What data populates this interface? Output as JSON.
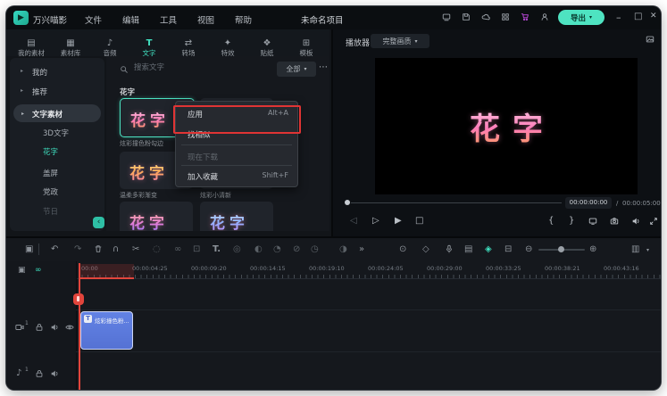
{
  "titlebar": {
    "app_name": "万兴喵影",
    "menus": [
      "文件",
      "编辑",
      "工具",
      "视图",
      "帮助"
    ],
    "project_title": "未命名项目",
    "export_label": "导出"
  },
  "tabs": [
    {
      "label": "我的素材",
      "glyph": "▤"
    },
    {
      "label": "素材库",
      "glyph": "▦"
    },
    {
      "label": "音频",
      "glyph": "♪"
    },
    {
      "label": "文字",
      "glyph": "T"
    },
    {
      "label": "转场",
      "glyph": "⇄"
    },
    {
      "label": "特效",
      "glyph": "✦"
    },
    {
      "label": "贴纸",
      "glyph": "❖"
    },
    {
      "label": "模板",
      "glyph": "⊞"
    }
  ],
  "sidebar": {
    "groups": [
      {
        "label": "我的"
      },
      {
        "label": "推荐"
      },
      {
        "label": "文字素材"
      }
    ],
    "subitems": [
      {
        "label": "3D文字"
      },
      {
        "label": "花字"
      },
      {
        "label": "盖屏"
      },
      {
        "label": "党政"
      },
      {
        "label": "节日"
      }
    ]
  },
  "media_panel": {
    "search_placeholder": "搜索文字",
    "filter_label": "全部",
    "section_title": "花字",
    "cards": [
      {
        "text": "花字",
        "caption": "炫彩撞色粉勾边"
      },
      {
        "text": "花字",
        "caption": "温柔多彩渐变"
      },
      {
        "caption": "炫彩小清新"
      },
      {
        "text": "花字"
      },
      {
        "text": "花字"
      }
    ]
  },
  "context_menu": {
    "items": [
      {
        "label": "应用",
        "shortcut": "Alt+A"
      },
      {
        "label": "找相似",
        "shortcut": ""
      },
      {
        "label": "现在下载",
        "shortcut": ""
      },
      {
        "label": "加入收藏",
        "shortcut": "Shift+F"
      }
    ]
  },
  "preview": {
    "panel_title": "播放器",
    "quality_label": "完整画质",
    "overlay_text": "花字",
    "current_time": "00:00:00:00",
    "separator": "/",
    "total_time": "00:00:05:00"
  },
  "timeline": {
    "ruler_labels": [
      "00:00",
      "00:00:04:25",
      "00:00:09:20",
      "00:00:14:15",
      "00:00:19:10",
      "00:00:24:05",
      "00:00:29:00",
      "00:00:33:25",
      "00:00:38:21",
      "00:00:43:16"
    ],
    "clip": {
      "badge": "T",
      "label": "炫彩撞色粉..."
    },
    "video_track_number": "1",
    "audio_track_number": "1"
  },
  "colors": {
    "accent": "#41e0c0",
    "red": "#e2453c",
    "clip_blue": "#5b7ade",
    "cart_purple": "#c04ae0"
  },
  "glyphs": {
    "logo": "▶",
    "minimize": "–",
    "maximize": "□",
    "close": "✕",
    "chevron_down": "▾",
    "caret_right": "▸",
    "more": "⋯",
    "collapse": "‹",
    "manage": "▣",
    "undo": "↶",
    "redo": "↷",
    "magnet": "∩",
    "split": "✂",
    "ripple": "◌",
    "link": "∞",
    "crop": "⊡",
    "text_tool": "T.",
    "motion": "◎",
    "chroma": "◐",
    "speed": "◔",
    "render": "⊘",
    "clock": "◷",
    "mask": "◑",
    "more_tools": "»",
    "record": "⊙",
    "shield": "◇",
    "preview_render": "▤",
    "keyframe": "◈",
    "marker": "⊟",
    "zoom_out": "⊖",
    "zoom_in": "⊕",
    "track_list": "▥",
    "prev_frame": "◁",
    "step_forward": "▷",
    "play": "▶",
    "stop": "□",
    "brace_open": "{",
    "brace_close": "}",
    "duplicate": "▣",
    "chain": "∞",
    "music_note": "♪"
  }
}
